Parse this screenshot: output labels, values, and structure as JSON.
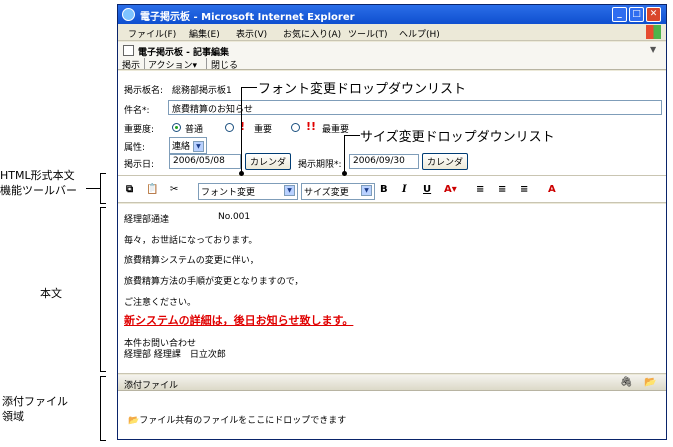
{
  "window": {
    "title": "電子掲示板 - Microsoft Internet Explorer"
  },
  "menu": [
    "ファイル(F)",
    "編集(E)",
    "表示(V)",
    "お気に入り(A)",
    "ツール(T)",
    "ヘルプ(H)"
  ],
  "app": {
    "title": "電子掲示板 - 記事編集",
    "toolbar": {
      "post": "掲示",
      "action": "アクション▾",
      "close": "閉じる"
    }
  },
  "form": {
    "board_label": "掲示板名:",
    "board_value": "総務部掲示板1",
    "subject_label": "件名*:",
    "subject_value": "旅費精算のお知らせ",
    "priority_label": "重要度:",
    "priority_normal": "普通",
    "priority_important": "重要",
    "priority_most": "最重要",
    "attribute_label": "属性:",
    "attribute_value": "連絡",
    "date_label": "掲示日:",
    "date_value": "2006/05/08",
    "calendar": "カレンダ",
    "expire_label": "掲示期限*:",
    "expire_value": "2006/09/30"
  },
  "editor_toolbar": {
    "font_select": "フォント変更",
    "size_select": "サイズ変更",
    "bold": "B",
    "italic": "I",
    "underline": "U"
  },
  "body_lines": {
    "l1a": "経理部通達",
    "l1b": "No.001",
    "l2": "毎々，お世話になっております。",
    "l3": "旅費精算システムの変更に伴い，",
    "l4": "旅費精算方法の手順が変更となりますので，",
    "l5": "ご注意ください。",
    "l6": "新システムの詳細は，後日お知らせ致します。",
    "l7": "本件お問い合わせ",
    "l8": "経理部 経理課　日立次郎"
  },
  "attach": {
    "header": "添付ファイル",
    "drop_text": "ファイル共有のファイルをここにドロップできます"
  },
  "annotations": {
    "font_dropdown": "フォント変更ドロップダウンリスト",
    "size_dropdown": "サイズ変更ドロップダウンリスト",
    "toolbar_label_1": "HTML形式本文",
    "toolbar_label_2": "機能ツールバー",
    "body_label": "本文",
    "attach_label_1": "添付ファイル",
    "attach_label_2": "領域"
  },
  "colors": {
    "titlebar": "#0f4fcf",
    "emphasis": "#e00000",
    "priority_mark": "#e00000"
  }
}
